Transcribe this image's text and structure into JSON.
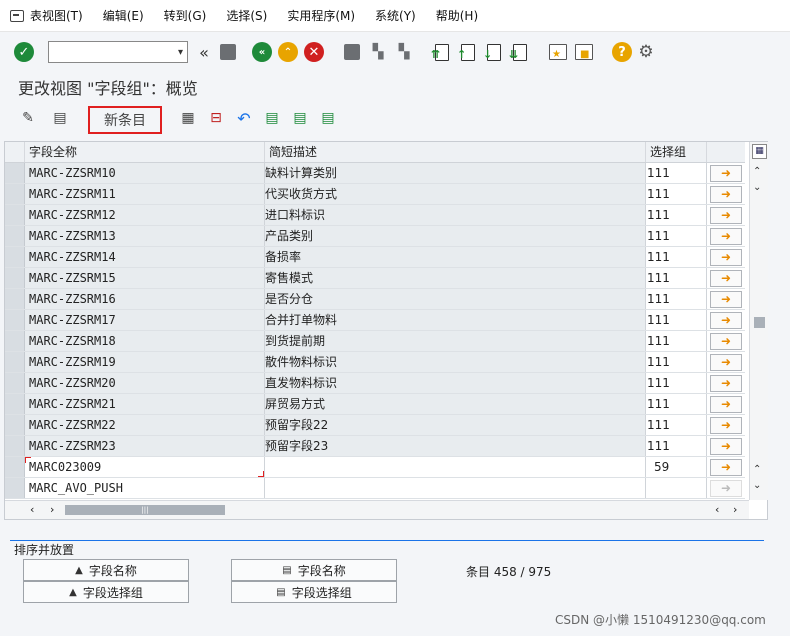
{
  "menu": [
    "表视图(T)",
    "编辑(E)",
    "转到(G)",
    "选择(S)",
    "实用程序(M)",
    "系统(Y)",
    "帮助(H)"
  ],
  "page_title": "更改视图 \"字段组\"：概览",
  "toolbar2": {
    "new_entry_label": "新条目"
  },
  "table": {
    "columns": [
      "字段全称",
      "简短描述",
      "选择组"
    ],
    "rows": [
      {
        "name": "MARC-ZZSRM10",
        "desc": "缺料计算类别",
        "group": "111"
      },
      {
        "name": "MARC-ZZSRM11",
        "desc": "代买收货方式",
        "group": "111"
      },
      {
        "name": "MARC-ZZSRM12",
        "desc": "进口料标识",
        "group": "111"
      },
      {
        "name": "MARC-ZZSRM13",
        "desc": "产品类别",
        "group": "111"
      },
      {
        "name": "MARC-ZZSRM14",
        "desc": "备损率",
        "group": "111"
      },
      {
        "name": "MARC-ZZSRM15",
        "desc": "寄售模式",
        "group": "111"
      },
      {
        "name": "MARC-ZZSRM16",
        "desc": "是否分仓",
        "group": "111"
      },
      {
        "name": "MARC-ZZSRM17",
        "desc": "合并打单物料",
        "group": "111"
      },
      {
        "name": "MARC-ZZSRM18",
        "desc": "到货提前期",
        "group": "111"
      },
      {
        "name": "MARC-ZZSRM19",
        "desc": "散件物料标识",
        "group": "111"
      },
      {
        "name": "MARC-ZZSRM20",
        "desc": "直发物料标识",
        "group": "111"
      },
      {
        "name": "MARC-ZZSRM21",
        "desc": "屏贸易方式",
        "group": "111"
      },
      {
        "name": "MARC-ZZSRM22",
        "desc": "预留字段22",
        "group": "111"
      },
      {
        "name": "MARC-ZZSRM23",
        "desc": "预留字段23",
        "group": "111"
      }
    ],
    "edit_rows": [
      {
        "name": "MARC023009",
        "desc": "",
        "group": "59"
      },
      {
        "name": "MARC_AVO_PUSH",
        "desc": "",
        "group": ""
      }
    ]
  },
  "bottom": {
    "group_title": "排序并放置",
    "sort_by_name": "字段名称",
    "sort_by_group": "字段选择组",
    "place_by_name": "字段名称",
    "place_by_group": "字段选择组",
    "entry_count": "条目 458 / 975"
  },
  "watermark": "CSDN @小懒 1510491230@qq.com",
  "colors": {
    "accent_blue": "#1a73e8",
    "highlight_red": "#e02020",
    "ok_green": "#1e8a3a",
    "arrow_orange": "#e88a00"
  }
}
